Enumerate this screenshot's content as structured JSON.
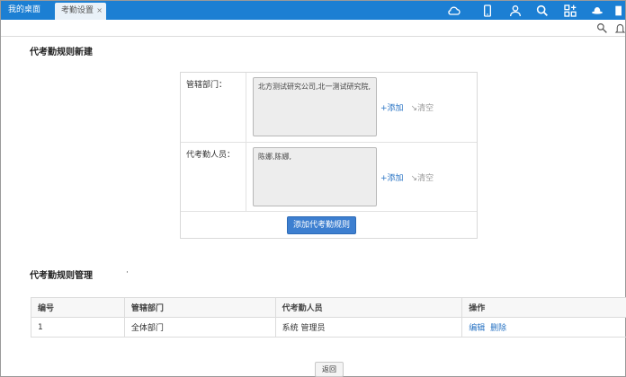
{
  "tabs": {
    "home": "我的桌面",
    "active": "考勤设置",
    "close": "×"
  },
  "toolbar_icons": [
    "cloud-icon",
    "mobile-icon",
    "user-icon",
    "search-icon",
    "apps-icon",
    "hat-icon"
  ],
  "colors": {
    "topbar": "#1c7fd3",
    "primary_button": "#3d7fd0",
    "link": "#2a74c4"
  },
  "create_section": {
    "title": "代考勤规则新建",
    "dept_label": "管辖部门：",
    "dept_value": "北方测试研究公司,北一测试研究院,",
    "person_label": "代考勤人员：",
    "person_value": "陈娜,陈娜,",
    "add_label": "添加",
    "clear_label": "清空",
    "submit_label": "添加代考勤规则"
  },
  "manage_section": {
    "title": "代考勤规则管理",
    "dot": "·",
    "columns": [
      "编号",
      "管辖部门",
      "代考勤人员",
      "操作"
    ],
    "rows": [
      {
        "id": "1",
        "dept": "全体部门",
        "person": "系统 管理员",
        "edit": "编辑",
        "delete": "删除"
      }
    ]
  },
  "back_label": "返回"
}
